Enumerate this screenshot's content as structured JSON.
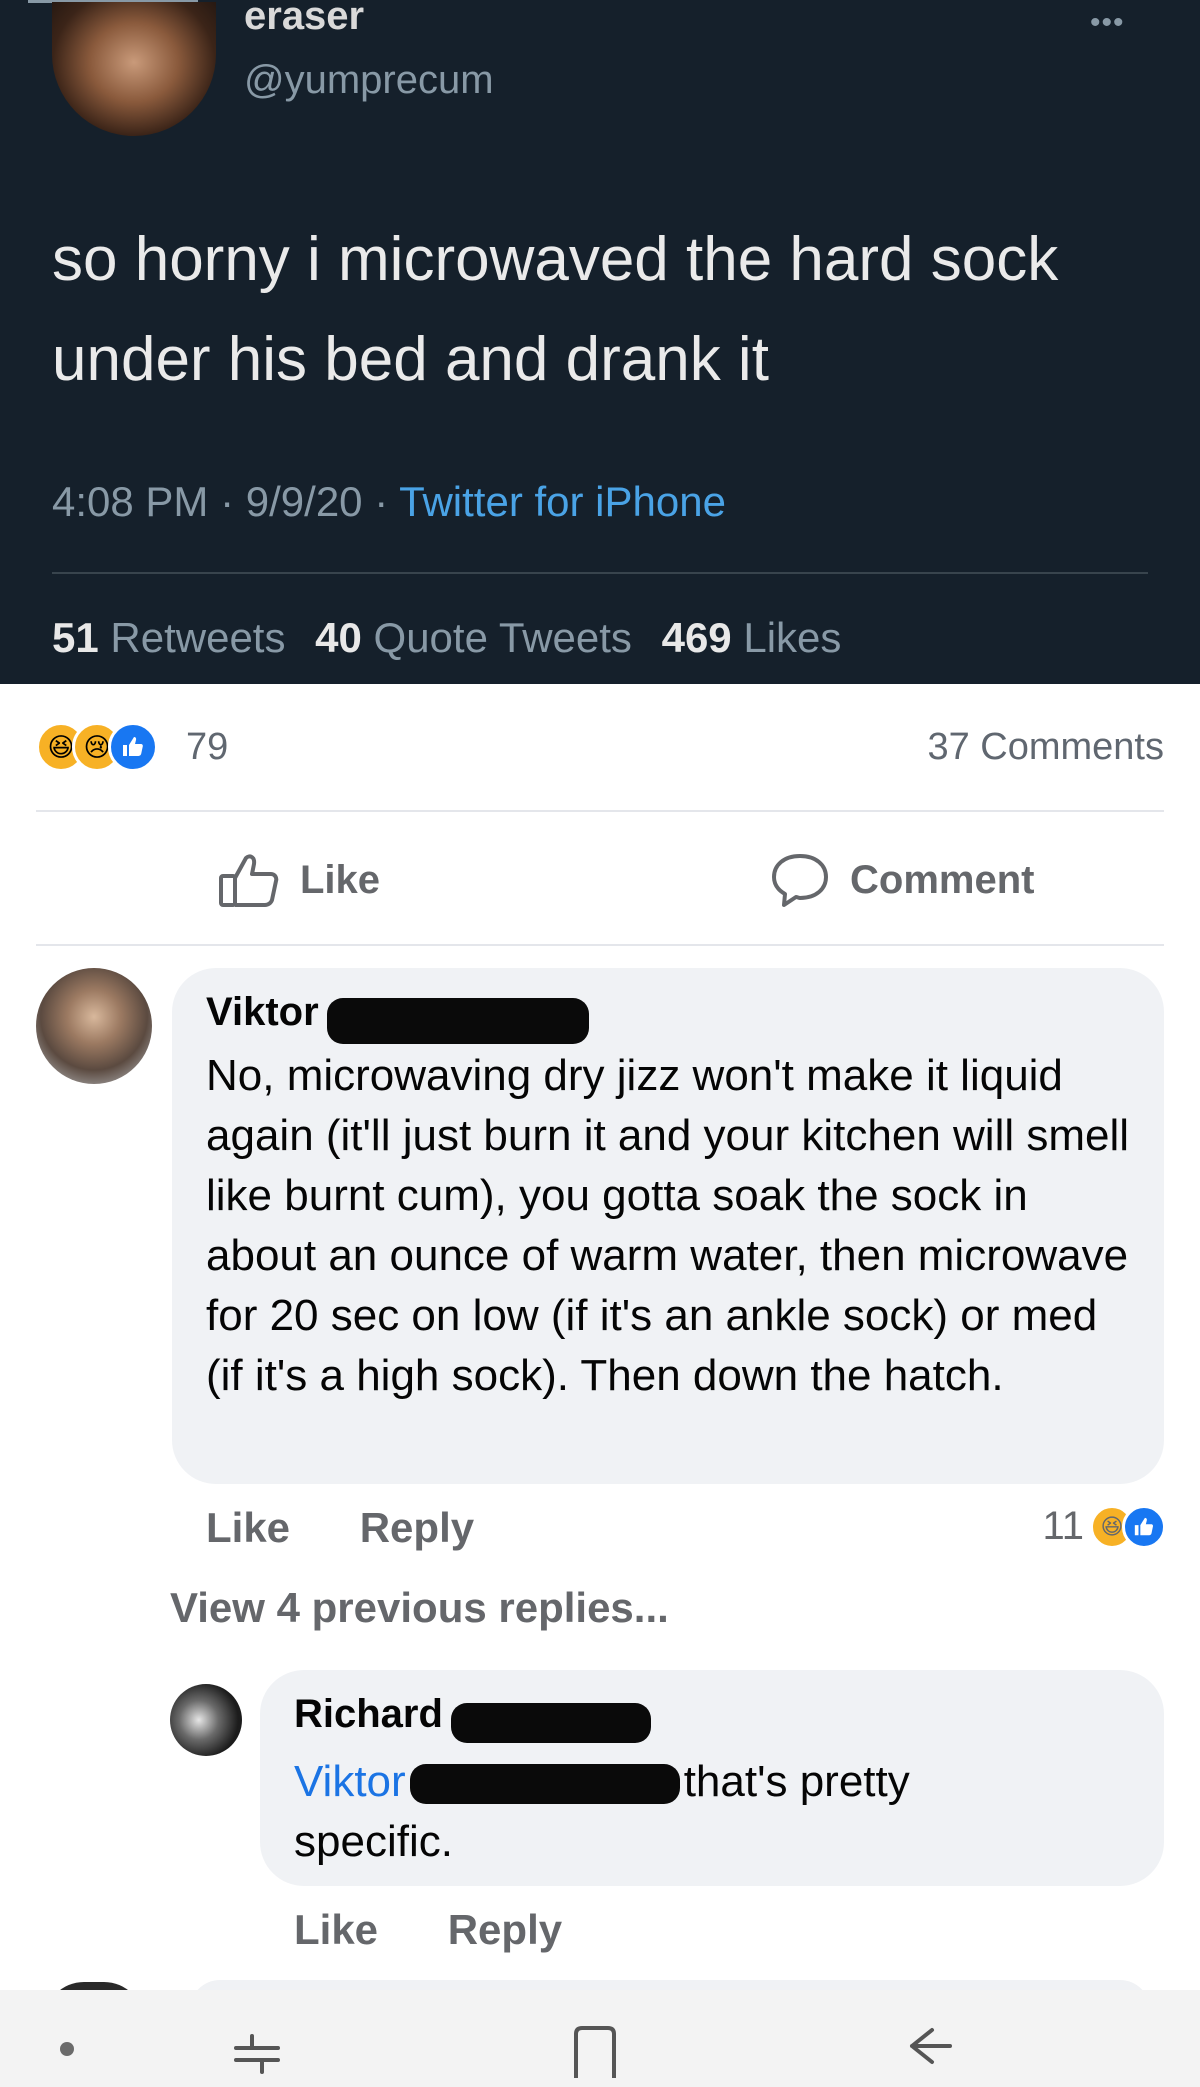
{
  "tweet": {
    "display_name": "eraser",
    "handle": "@yumprecum",
    "more_icon": "more-dots-icon",
    "text": "so horny i microwaved the hard sock under his bed and drank it",
    "time": "4:08 PM",
    "date": "9/9/20",
    "source": "Twitter for iPhone",
    "sep": "·",
    "stats": {
      "retweets_count": "51",
      "retweets_label": "Retweets",
      "quotes_count": "40",
      "quotes_label": "Quote Tweets",
      "likes_count": "469",
      "likes_label": "Likes"
    },
    "colors": {
      "background": "#15202b",
      "link": "#4aa3e6",
      "muted": "#8899a6"
    }
  },
  "post": {
    "reaction_icons": [
      "haha-reaction-icon",
      "sad-reaction-icon",
      "like-reaction-icon"
    ],
    "reaction_count": "79",
    "comments_count": "37 Comments",
    "like_label": "Like",
    "comment_label": "Comment"
  },
  "comments": [
    {
      "author": "Viktor",
      "text": "No, microwaving dry jizz won't make it liquid again (it'll just burn it and your kitchen will smell like burnt cum), you gotta soak the sock in about an ounce of warm water, then microwave for 20 sec on low (if it's an ankle sock) or med (if it's a high sock). Then down the hatch.",
      "like_label": "Like",
      "reply_label": "Reply",
      "reaction_count": "11"
    }
  ],
  "view_previous": "View 4 previous replies...",
  "reply": {
    "author": "Richard",
    "mention": "Viktor",
    "text_after_mention": "that's pretty",
    "text_line2": "specific.",
    "like_label": "Like",
    "reply_label": "Reply"
  },
  "nav": {
    "icons": [
      "recents-icon",
      "home-icon",
      "back-icon"
    ]
  }
}
